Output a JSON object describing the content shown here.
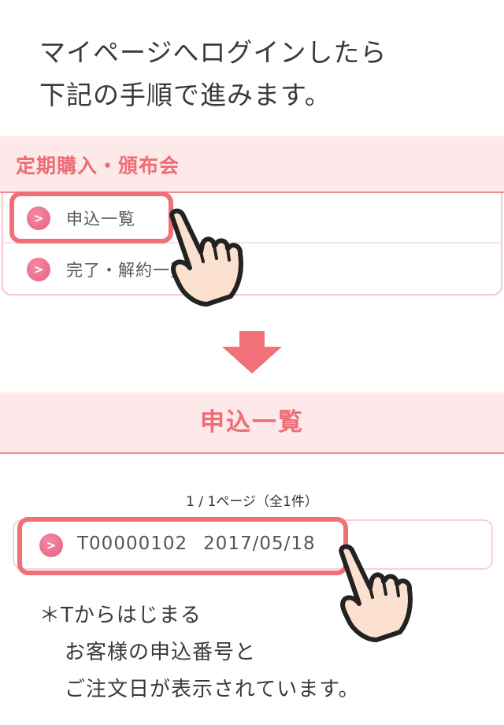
{
  "intro": {
    "line1": "マイページへログインしたら",
    "line2": "下記の手順で進みます。"
  },
  "section": {
    "title": "定期購入・頒布会",
    "items": [
      {
        "label": "申込一覧"
      },
      {
        "label": "完了・解約一覧"
      }
    ]
  },
  "page2": {
    "title": "申込一覧",
    "pager": "1 / 1ページ（全1件）",
    "order": {
      "id": "T00000102",
      "date": "2017/05/18"
    }
  },
  "note": {
    "line1": "＊Tからはじまる",
    "line2": "お客様の申込番号と",
    "line3": "ご注文日が表示されています。"
  },
  "colors": {
    "accent": "#ee6d75",
    "band": "#fde8ea",
    "highlight": "#ef7077",
    "arrow": "#f07178"
  },
  "icons": [
    "chevron-right-icon",
    "pointing-hand-icon",
    "down-arrow-icon"
  ]
}
